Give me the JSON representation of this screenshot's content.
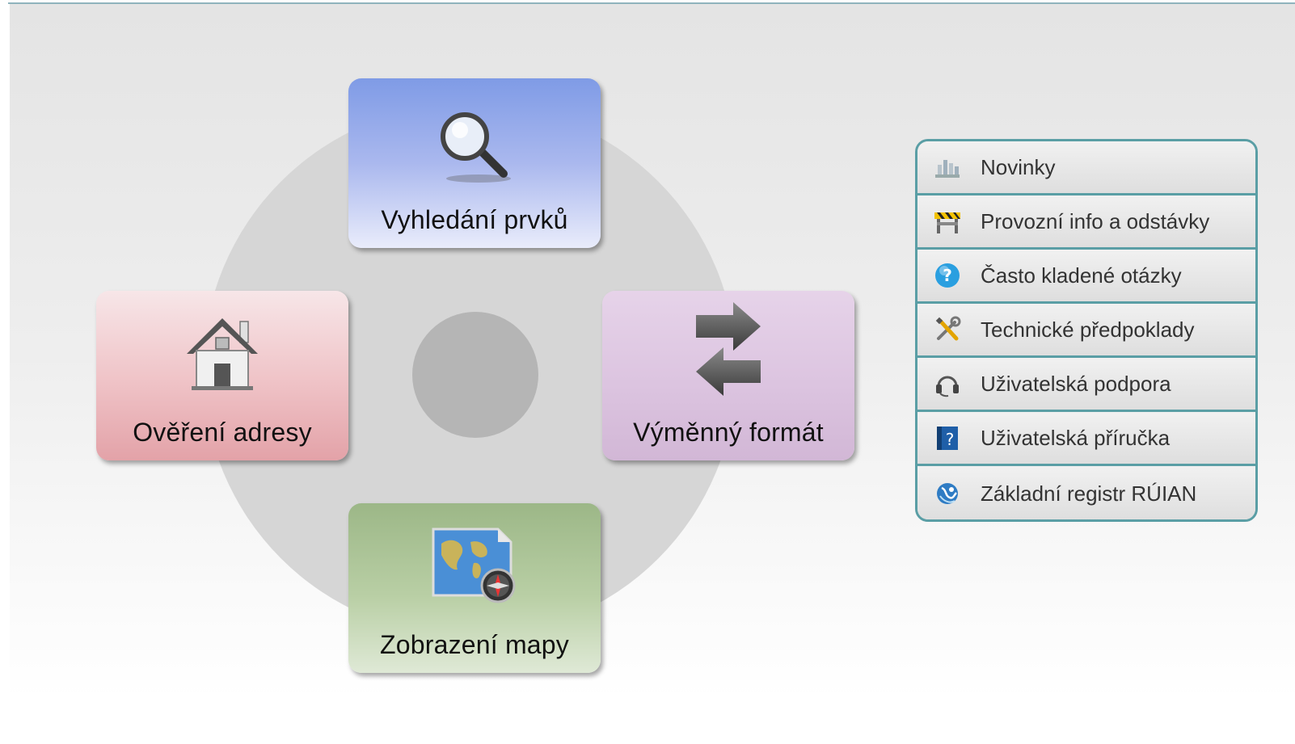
{
  "tiles": {
    "search": {
      "label": "Vyhledání prvků",
      "icon": "magnifier-icon"
    },
    "address": {
      "label": "Ověření adresy",
      "icon": "house-icon"
    },
    "format": {
      "label": "Výměnný formát",
      "icon": "exchange-arrows-icon"
    },
    "map": {
      "label": "Zobrazení mapy",
      "icon": "world-map-compass-icon"
    }
  },
  "menu": {
    "items": [
      {
        "label": "Novinky",
        "icon": "news-icon"
      },
      {
        "label": "Provozní info a odstávky",
        "icon": "road-barrier-icon"
      },
      {
        "label": "Často kladené otázky",
        "icon": "question-icon"
      },
      {
        "label": "Technické předpoklady",
        "icon": "tools-icon"
      },
      {
        "label": "Uživatelská podpora",
        "icon": "headset-icon"
      },
      {
        "label": "Uživatelská příručka",
        "icon": "help-book-icon"
      },
      {
        "label": "Základní registr RÚIAN",
        "icon": "registry-logo-icon"
      }
    ]
  },
  "colors": {
    "accent": "#5a9ea5",
    "search_tile": "#7f9be6",
    "address_tile": "#efc2c6",
    "format_tile": "#dcc4e0",
    "map_tile": "#b9cfa5"
  }
}
